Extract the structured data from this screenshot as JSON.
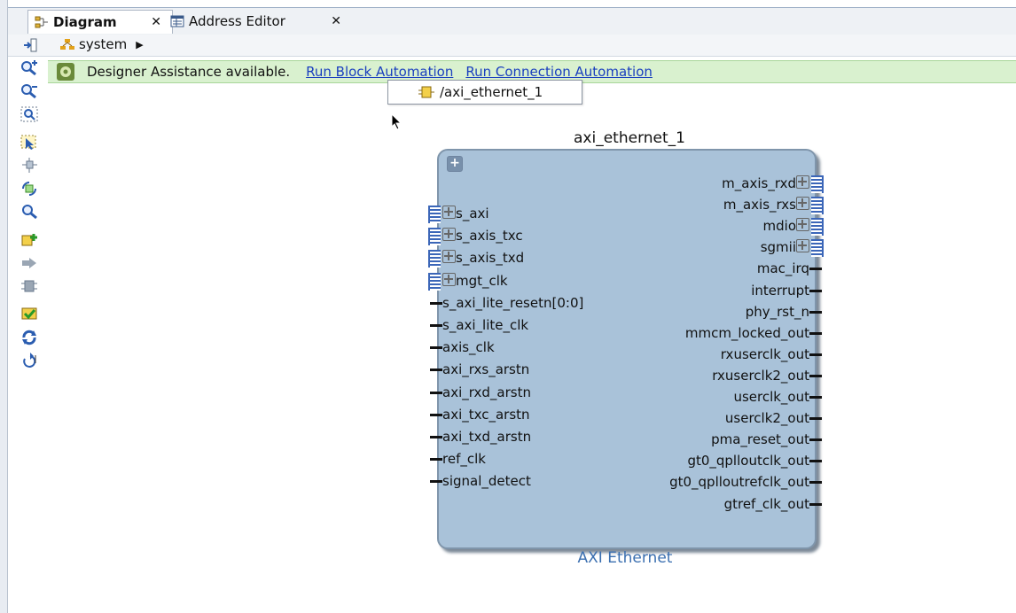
{
  "tabs": [
    {
      "label": "Diagram",
      "icon": "diagram-icon",
      "active": true
    },
    {
      "label": "Address Editor",
      "icon": "address-editor-icon",
      "active": false
    }
  ],
  "breadcrumb": {
    "label": "system",
    "icon": "hierarchy-icon"
  },
  "banner": {
    "message": "Designer Assistance available.",
    "link_block": "Run Block Automation",
    "link_connection": "Run Connection Automation"
  },
  "popup": {
    "item": "/axi_ethernet_1"
  },
  "block": {
    "name": "axi_ethernet_1",
    "type_label": "AXI Ethernet",
    "left_ports": [
      {
        "label": "s_axi",
        "kind": "bus"
      },
      {
        "label": "s_axis_txc",
        "kind": "bus"
      },
      {
        "label": "s_axis_txd",
        "kind": "bus"
      },
      {
        "label": "mgt_clk",
        "kind": "bus"
      },
      {
        "label": "s_axi_lite_resetn[0:0]",
        "kind": "wire"
      },
      {
        "label": "s_axi_lite_clk",
        "kind": "wire"
      },
      {
        "label": "axis_clk",
        "kind": "wire"
      },
      {
        "label": "axi_rxs_arstn",
        "kind": "wire"
      },
      {
        "label": "axi_rxd_arstn",
        "kind": "wire"
      },
      {
        "label": "axi_txc_arstn",
        "kind": "wire"
      },
      {
        "label": "axi_txd_arstn",
        "kind": "wire"
      },
      {
        "label": "ref_clk",
        "kind": "wire"
      },
      {
        "label": "signal_detect",
        "kind": "wire"
      }
    ],
    "right_ports": [
      {
        "label": "m_axis_rxd",
        "kind": "bus"
      },
      {
        "label": "m_axis_rxs",
        "kind": "bus"
      },
      {
        "label": "mdio",
        "kind": "bus"
      },
      {
        "label": "sgmii",
        "kind": "bus"
      },
      {
        "label": "mac_irq",
        "kind": "wire"
      },
      {
        "label": "interrupt",
        "kind": "wire"
      },
      {
        "label": "phy_rst_n",
        "kind": "wire"
      },
      {
        "label": "mmcm_locked_out",
        "kind": "wire"
      },
      {
        "label": "rxuserclk_out",
        "kind": "wire"
      },
      {
        "label": "rxuserclk2_out",
        "kind": "wire"
      },
      {
        "label": "userclk_out",
        "kind": "wire"
      },
      {
        "label": "userclk2_out",
        "kind": "wire"
      },
      {
        "label": "pma_reset_out",
        "kind": "wire"
      },
      {
        "label": "gt0_qplloutclk_out",
        "kind": "wire"
      },
      {
        "label": "gt0_qplloutrefclk_out",
        "kind": "wire"
      },
      {
        "label": "gtref_clk_out",
        "kind": "wire"
      }
    ]
  },
  "toolbar_icons": [
    "zoom-in-icon",
    "zoom-out-icon",
    "zoom-fit-icon",
    "select-area-icon",
    "auto-connect-icon",
    "regenerate-layout-icon",
    "search-icon",
    "add-ip-icon",
    "make-external-icon",
    "validate-icon",
    "run-validation-icon",
    "refresh-icon",
    "undo-layout-icon"
  ],
  "colors": {
    "banner_bg": "#d9f1cf",
    "block_fill": "#a9c2d9",
    "link": "#1a3fbf",
    "type_label": "#3b6fb0"
  }
}
